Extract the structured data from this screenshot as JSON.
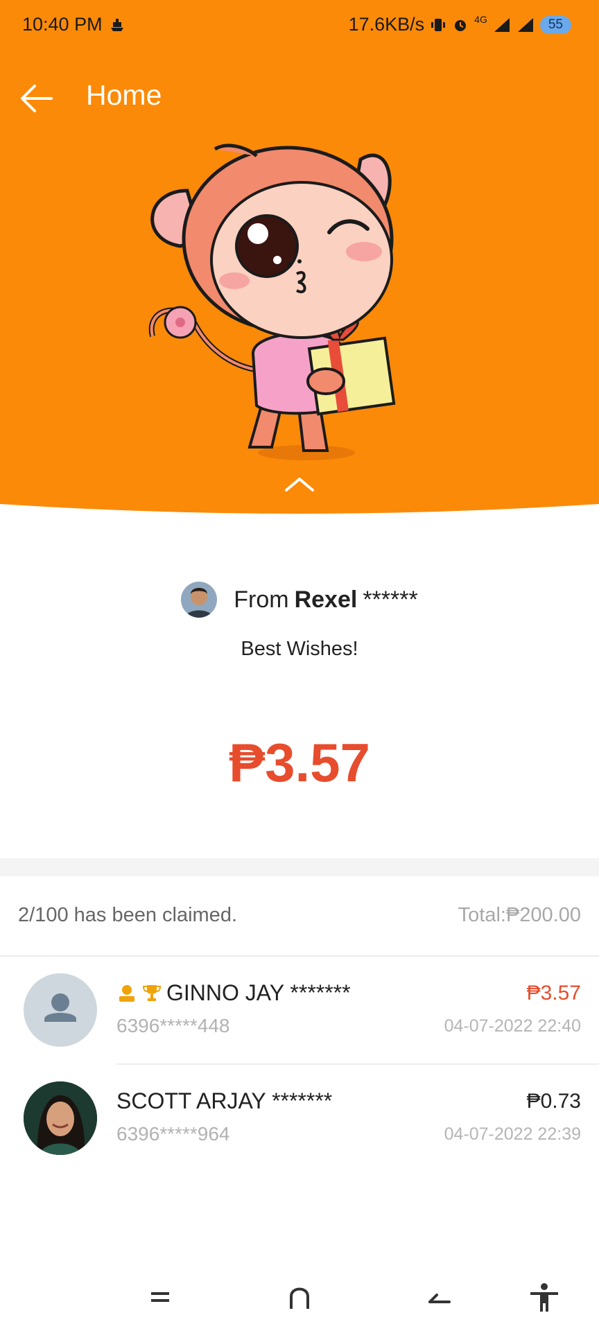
{
  "status_bar": {
    "time": "10:40 PM",
    "network_speed": "17.6KB/s",
    "network_type": "4G",
    "battery": "55"
  },
  "app_bar": {
    "title": "Home"
  },
  "sender": {
    "prefix": "From",
    "name": "Rexel",
    "mask": "******",
    "message": "Best Wishes!"
  },
  "amount": "₱3.57",
  "summary": {
    "claimed": "2/100 has been claimed.",
    "total": "Total:₱200.00"
  },
  "claims": [
    {
      "name": "GINNO JAY *******",
      "phone": "6396*****448",
      "amount": "₱3.57",
      "time": "04-07-2022 22:40",
      "badges": [
        "user-badge-icon",
        "trophy-icon"
      ],
      "amount_color": "#e74c2d"
    },
    {
      "name": "SCOTT ARJAY *******",
      "phone": "6396*****964",
      "amount": "₱0.73",
      "time": "04-07-2022 22:39",
      "amount_color": "#222222"
    }
  ],
  "colors": {
    "header": "#fb8a08",
    "accent": "#e74c2d",
    "badge": "#f0a20a"
  }
}
